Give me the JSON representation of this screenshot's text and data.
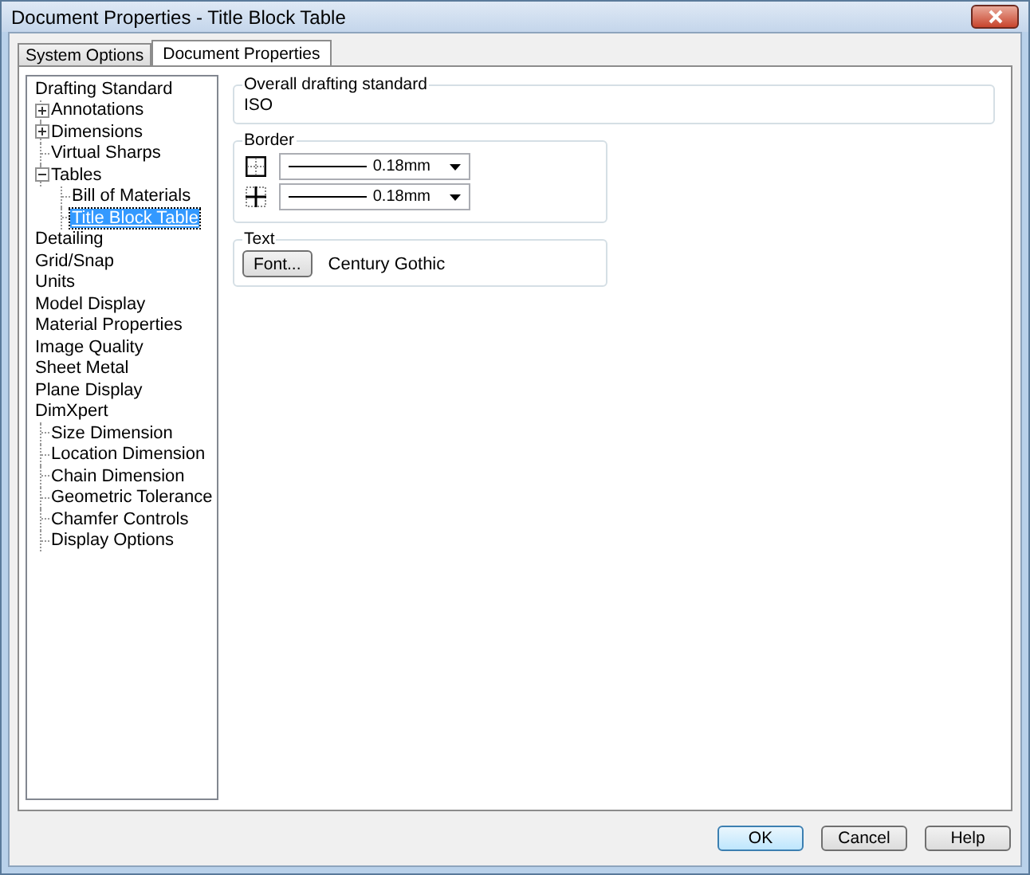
{
  "window": {
    "title": "Document Properties - Title Block Table"
  },
  "tabs": [
    {
      "label": "System Options",
      "selected": false
    },
    {
      "label": "Document Properties",
      "selected": true
    }
  ],
  "tree": [
    {
      "label": "Drafting Standard",
      "selected": false,
      "children": [
        {
          "label": "Annotations",
          "selected": false,
          "expanded": false
        },
        {
          "label": "Dimensions",
          "selected": false,
          "expanded": false
        },
        {
          "label": "Virtual Sharps",
          "selected": false
        },
        {
          "label": "Tables",
          "selected": false,
          "expanded": true,
          "children": [
            {
              "label": "Bill of Materials",
              "selected": false
            },
            {
              "label": "Title Block Table",
              "selected": true
            }
          ]
        }
      ]
    },
    {
      "label": "Detailing",
      "selected": false
    },
    {
      "label": "Grid/Snap",
      "selected": false
    },
    {
      "label": "Units",
      "selected": false
    },
    {
      "label": "Model Display",
      "selected": false
    },
    {
      "label": "Material Properties",
      "selected": false
    },
    {
      "label": "Image Quality",
      "selected": false
    },
    {
      "label": "Sheet Metal",
      "selected": false
    },
    {
      "label": "Plane Display",
      "selected": false
    },
    {
      "label": "DimXpert",
      "selected": false,
      "children": [
        {
          "label": "Size Dimension",
          "selected": false
        },
        {
          "label": "Location Dimension",
          "selected": false
        },
        {
          "label": "Chain Dimension",
          "selected": false
        },
        {
          "label": "Geometric Tolerance",
          "selected": false
        },
        {
          "label": "Chamfer Controls",
          "selected": false
        },
        {
          "label": "Display Options",
          "selected": false
        }
      ]
    }
  ],
  "overall": {
    "title": "Overall drafting standard",
    "value": "ISO"
  },
  "border": {
    "title": "Border",
    "rows": [
      {
        "kind": "outer",
        "value": "0.18mm"
      },
      {
        "kind": "inner",
        "value": "0.18mm"
      }
    ]
  },
  "text": {
    "title": "Text",
    "button": "Font...",
    "font": "Century Gothic"
  },
  "buttons": [
    {
      "label": "OK",
      "default": true
    },
    {
      "label": "Cancel",
      "default": false
    },
    {
      "label": "Help",
      "default": false
    }
  ]
}
